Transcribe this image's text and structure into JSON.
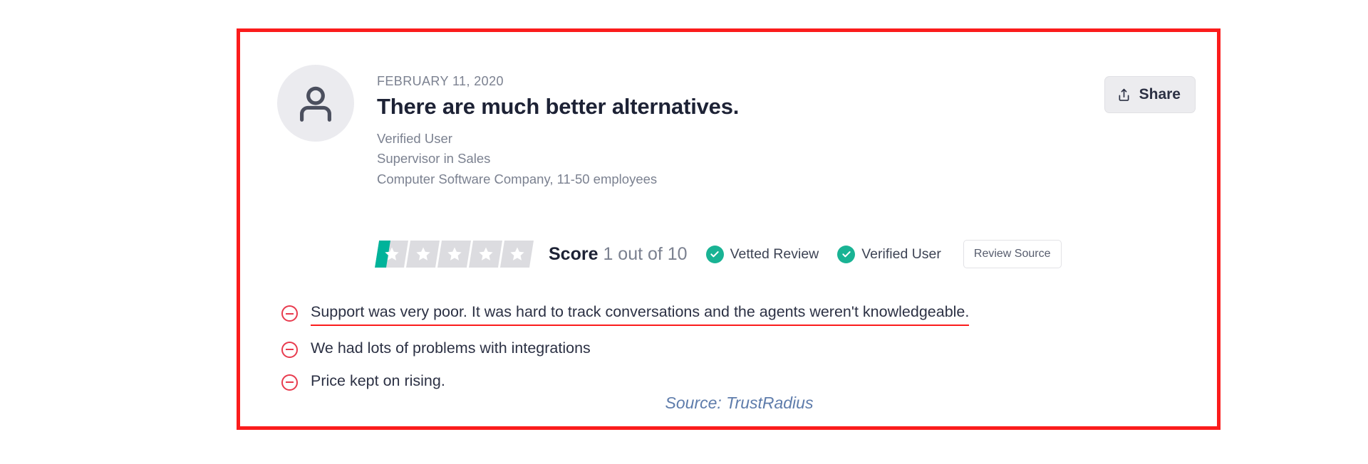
{
  "annotation": {
    "border_color": "#fb1c1c"
  },
  "review": {
    "date": "FEBRUARY 11, 2020",
    "title": "There are much better alternatives.",
    "reviewer": {
      "name": "Verified User",
      "role": "Supervisor in Sales",
      "company": "Computer Software Company, 11-50 employees"
    },
    "avatar_icon": "person-icon",
    "share_button": {
      "label": "Share",
      "icon": "share-upload-icon"
    },
    "rating": {
      "stars_total": 5,
      "stars_filled": 0.4,
      "fill_color": "#00b39a",
      "empty_color": "#dcdce0",
      "score_label": "Score",
      "score_value": "1 out of 10"
    },
    "badges": [
      {
        "label": "Vetted Review",
        "icon": "check-circle-icon",
        "color": "#19b394"
      },
      {
        "label": "Verified User",
        "icon": "check-circle-icon",
        "color": "#19b394"
      }
    ],
    "review_source_button": {
      "label": "Review Source"
    },
    "cons": [
      {
        "text": "Support was very poor. It was hard to track conversations and the agents weren't knowledgeable.",
        "icon": "minus-circle-icon",
        "highlighted": true
      },
      {
        "text": "We had lots of problems with integrations",
        "icon": "minus-circle-icon",
        "highlighted": false
      },
      {
        "text": "Price kept on rising.",
        "icon": "minus-circle-icon",
        "highlighted": false
      }
    ],
    "source_caption": "Source: TrustRadius"
  }
}
